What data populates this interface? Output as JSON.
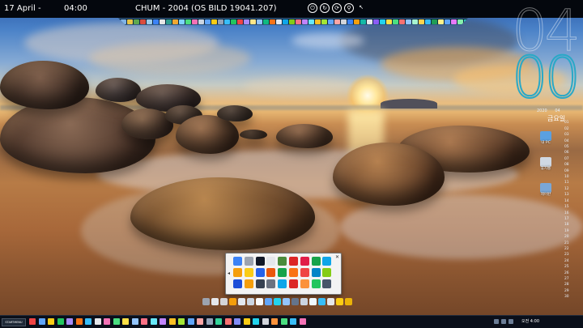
{
  "topbar": {
    "date": "17 April -",
    "time": "04:00",
    "system_name": "CHUM - 2004 (OS BILD 19041.207)",
    "controls": [
      {
        "name": "power-icon",
        "glyph": "⏻"
      },
      {
        "name": "restart-icon",
        "glyph": "↻"
      },
      {
        "name": "refresh-icon",
        "glyph": "⟳"
      },
      {
        "name": "search-icon",
        "glyph": "⚲"
      },
      {
        "name": "pin-icon",
        "glyph": "↖"
      }
    ]
  },
  "top_dock_icon_colors": [
    "#7fb2e5",
    "#e8c547",
    "#5ea84f",
    "#d94c3d",
    "#9ecbe8",
    "#3b82f6",
    "#e6e6e6",
    "#2f9e8f",
    "#f0a830",
    "#7dd3fc",
    "#4ade80",
    "#f472b6",
    "#cbd5e1",
    "#60a5fa",
    "#facc15",
    "#94a3b8",
    "#38bdf8",
    "#22c55e",
    "#ef4444",
    "#a78bfa",
    "#fde68a",
    "#93c5fd",
    "#10b981",
    "#f97316",
    "#e2e8f0",
    "#0ea5e9",
    "#84cc16",
    "#fb7185",
    "#c084fc",
    "#67e8f9",
    "#fbbf24",
    "#a3e635",
    "#60a5fa",
    "#fca5a5",
    "#d1d5db",
    "#3b82f6",
    "#f59e0b",
    "#14b8a6",
    "#e5e7eb",
    "#8b5cf6",
    "#22d3ee",
    "#fde047",
    "#4ade80",
    "#f87171",
    "#93c5fd",
    "#a7f3d0",
    "#fcd34d",
    "#38bdf8",
    "#1f9d55",
    "#fef08a",
    "#60a5fa",
    "#e879f9",
    "#86efac",
    "#2dd4bf"
  ],
  "big_clock": {
    "hours": "04",
    "minutes": "00"
  },
  "calendar": {
    "header_left": "2020",
    "header_right": "04",
    "day_label": "금요일",
    "rows": [
      "",
      "01",
      "02",
      "03",
      "04",
      "05",
      "06",
      "07",
      "08",
      "09",
      "10",
      "11",
      "12",
      "13",
      "14",
      "15",
      "16",
      "17",
      "18",
      "19",
      "20",
      "21",
      "22",
      "23",
      "24",
      "25",
      "26",
      "27",
      "28",
      "29",
      "30"
    ]
  },
  "desktop_icons": [
    {
      "name": "this-pc-icon",
      "label": "내 PC",
      "color": "#5aa0e0"
    },
    {
      "name": "recycle-bin-icon",
      "label": "휴지통",
      "color": "#cfd8e3"
    },
    {
      "name": "network-icon",
      "label": "제어판",
      "color": "#7aa7d6"
    }
  ],
  "launcher": {
    "left_arrow": "◂",
    "close": "✕",
    "icon_colors": [
      "#3b82f6",
      "#9ca3af",
      "#111827",
      "#e5e7eb",
      "#4b8b3b",
      "#dc2626",
      "#e11d48",
      "#16a34a",
      "#0ea5e9",
      "#f59e0b",
      "#facc15",
      "#2563eb",
      "#ea580c",
      "#16a34a",
      "#f97316",
      "#ef4444",
      "#0284c7",
      "#84cc16",
      "#1d4ed8",
      "#f59e0b",
      "#374151",
      "#6b7280",
      "#0ea5e9",
      "#dc2626",
      "#fb923c",
      "#22c55e",
      "#475569"
    ]
  },
  "bottom_dock_icon_colors": [
    "#9ca3af",
    "#e5e7eb",
    "#d4d4d8",
    "#f59e0b",
    "#e2e8f0",
    "#cbd5e1",
    "#f8fafc",
    "#60a5fa",
    "#22d3ee",
    "#93c5fd",
    "#64748b",
    "#cbd5e1",
    "#f0f9ff",
    "#38bdf8",
    "#e5e7eb",
    "#facc15",
    "#eab308"
  ],
  "taskbar": {
    "start_label": "STARTMENU",
    "icon_colors": [
      "#ef4444",
      "#60a5fa",
      "#facc15",
      "#22c55e",
      "#a78bfa",
      "#f97316",
      "#38bdf8",
      "#e5e7eb",
      "#f472b6",
      "#4ade80",
      "#fde047",
      "#93c5fd",
      "#fb7185",
      "#67e8f9",
      "#c084fc",
      "#fbbf24",
      "#a3e635",
      "#60a5fa",
      "#fca5a5",
      "#94a3b8",
      "#34d399",
      "#f87171",
      "#818cf8",
      "#facc15",
      "#22d3ee",
      "#d1d5db",
      "#fb923c",
      "#4ade80",
      "#38bdf8",
      "#f472b6"
    ],
    "clock": "오전 4:00"
  }
}
